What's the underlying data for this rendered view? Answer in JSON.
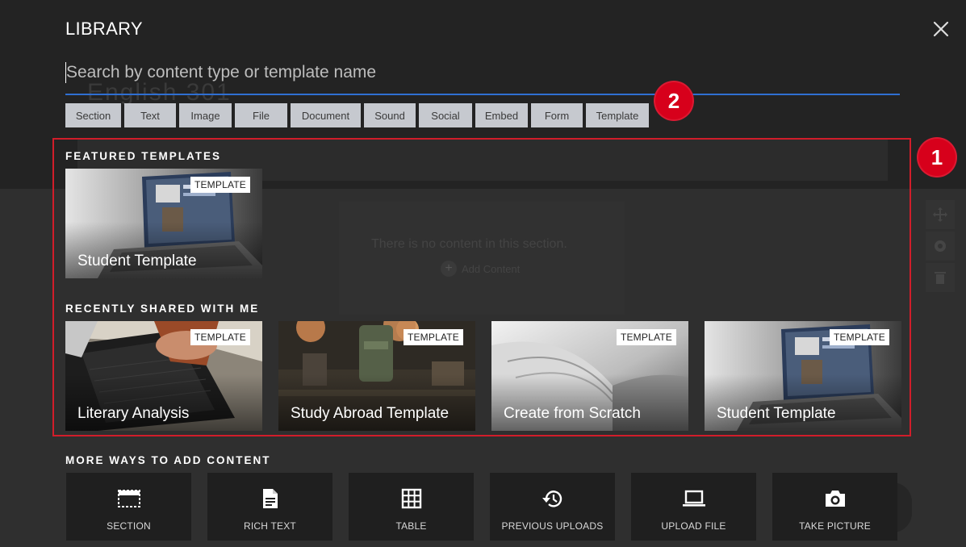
{
  "background": {
    "ghost_title": "English 301",
    "empty_text": "There is no content in this section.",
    "add_content": "Add Content"
  },
  "library": {
    "title": "LIBRARY",
    "close_icon": "close-icon",
    "search": {
      "placeholder": "Search by content type or template name",
      "value": ""
    },
    "filters": [
      "Section",
      "Text",
      "Image",
      "File",
      "Document",
      "Sound",
      "Social",
      "Embed",
      "Form",
      "Template"
    ],
    "badges": [
      "1",
      "2"
    ],
    "featured": {
      "heading": "FEATURED TEMPLATES",
      "cards": [
        {
          "tag": "TEMPLATE",
          "name": "Student Template",
          "image": "laptop-image"
        }
      ]
    },
    "recent": {
      "heading": "RECENTLY SHARED WITH ME",
      "cards": [
        {
          "tag": "TEMPLATE",
          "name": "Literary Analysis",
          "image": "hands-laptop-image"
        },
        {
          "tag": "TEMPLATE",
          "name": "Study Abroad Template",
          "image": "globes-backpack-image"
        },
        {
          "tag": "TEMPLATE",
          "name": "Create from Scratch",
          "image": "open-book-image"
        },
        {
          "tag": "TEMPLATE",
          "name": "Student Template",
          "image": "laptop-image"
        }
      ]
    },
    "more": {
      "heading": "MORE WAYS TO ADD CONTENT",
      "tiles": [
        {
          "label": "SECTION",
          "icon": "section-icon"
        },
        {
          "label": "RICH TEXT",
          "icon": "document-icon"
        },
        {
          "label": "TABLE",
          "icon": "table-icon"
        },
        {
          "label": "PREVIOUS UPLOADS",
          "icon": "history-icon"
        },
        {
          "label": "UPLOAD FILE",
          "icon": "laptop-icon"
        },
        {
          "label": "TAKE PICTURE",
          "icon": "camera-icon"
        }
      ]
    }
  },
  "colors": {
    "accent_blue": "#2f6fd2",
    "badge_red": "#d7001b",
    "chip_bg": "#c6c9cf"
  }
}
